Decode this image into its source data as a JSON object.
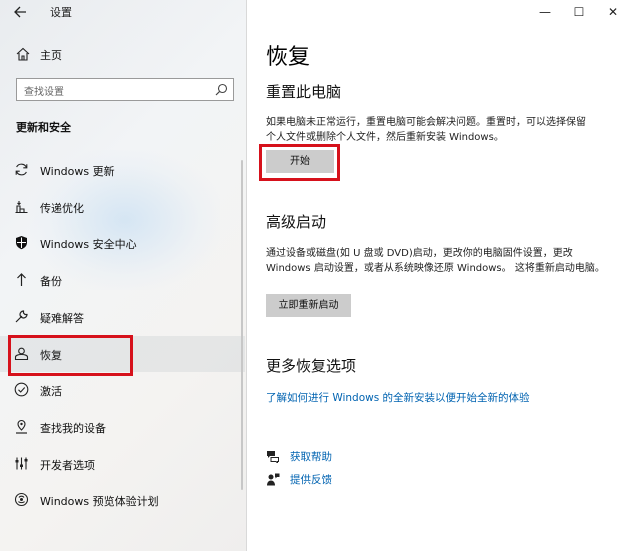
{
  "window": {
    "app_title": "设置",
    "back_icon": "back-arrow-icon",
    "controls": [
      "—",
      "☐",
      "✕"
    ]
  },
  "sidebar": {
    "home_label": "主页",
    "search_placeholder": "查找设置",
    "section_title": "更新和安全",
    "items": [
      {
        "label": "Windows 更新",
        "icon": "refresh-icon"
      },
      {
        "label": "传递优化",
        "icon": "delivery-optimization-icon"
      },
      {
        "label": "Windows 安全中心",
        "icon": "shield-icon"
      },
      {
        "label": "备份",
        "icon": "backup-arrow-icon"
      },
      {
        "label": "疑难解答",
        "icon": "wrench-icon"
      },
      {
        "label": "恢复",
        "icon": "recovery-icon",
        "selected": true
      },
      {
        "label": "激活",
        "icon": "check-circle-icon"
      },
      {
        "label": "查找我的设备",
        "icon": "find-device-icon"
      },
      {
        "label": "开发者选项",
        "icon": "developer-icon"
      },
      {
        "label": "Windows 预览体验计划",
        "icon": "insider-icon"
      }
    ]
  },
  "main": {
    "title": "恢复",
    "reset": {
      "heading": "重置此电脑",
      "line1": "如果电脑未正常运行，重置电脑可能会解决问题。重置时，可以选择保留",
      "line2": "个人文件或删除个人文件，然后重新安装 Windows。",
      "button": "开始"
    },
    "advanced": {
      "heading": "高级启动",
      "line1": "通过设备或磁盘(如 U 盘或 DVD)启动，更改你的电脑固件设置，更改",
      "line2": "Windows 启动设置，或者从系统映像还原 Windows。 这将重新启动电脑。",
      "button": "立即重新启动"
    },
    "more": {
      "heading": "更多恢复选项",
      "link": "了解如何进行 Windows 的全新安装以便开始全新的体验"
    },
    "help": {
      "get_help": "获取帮助",
      "feedback": "提供反馈"
    }
  },
  "colors": {
    "accent_link": "#0063b1",
    "annotation_red": "#d6111b",
    "button_gray": "#cccccc"
  }
}
